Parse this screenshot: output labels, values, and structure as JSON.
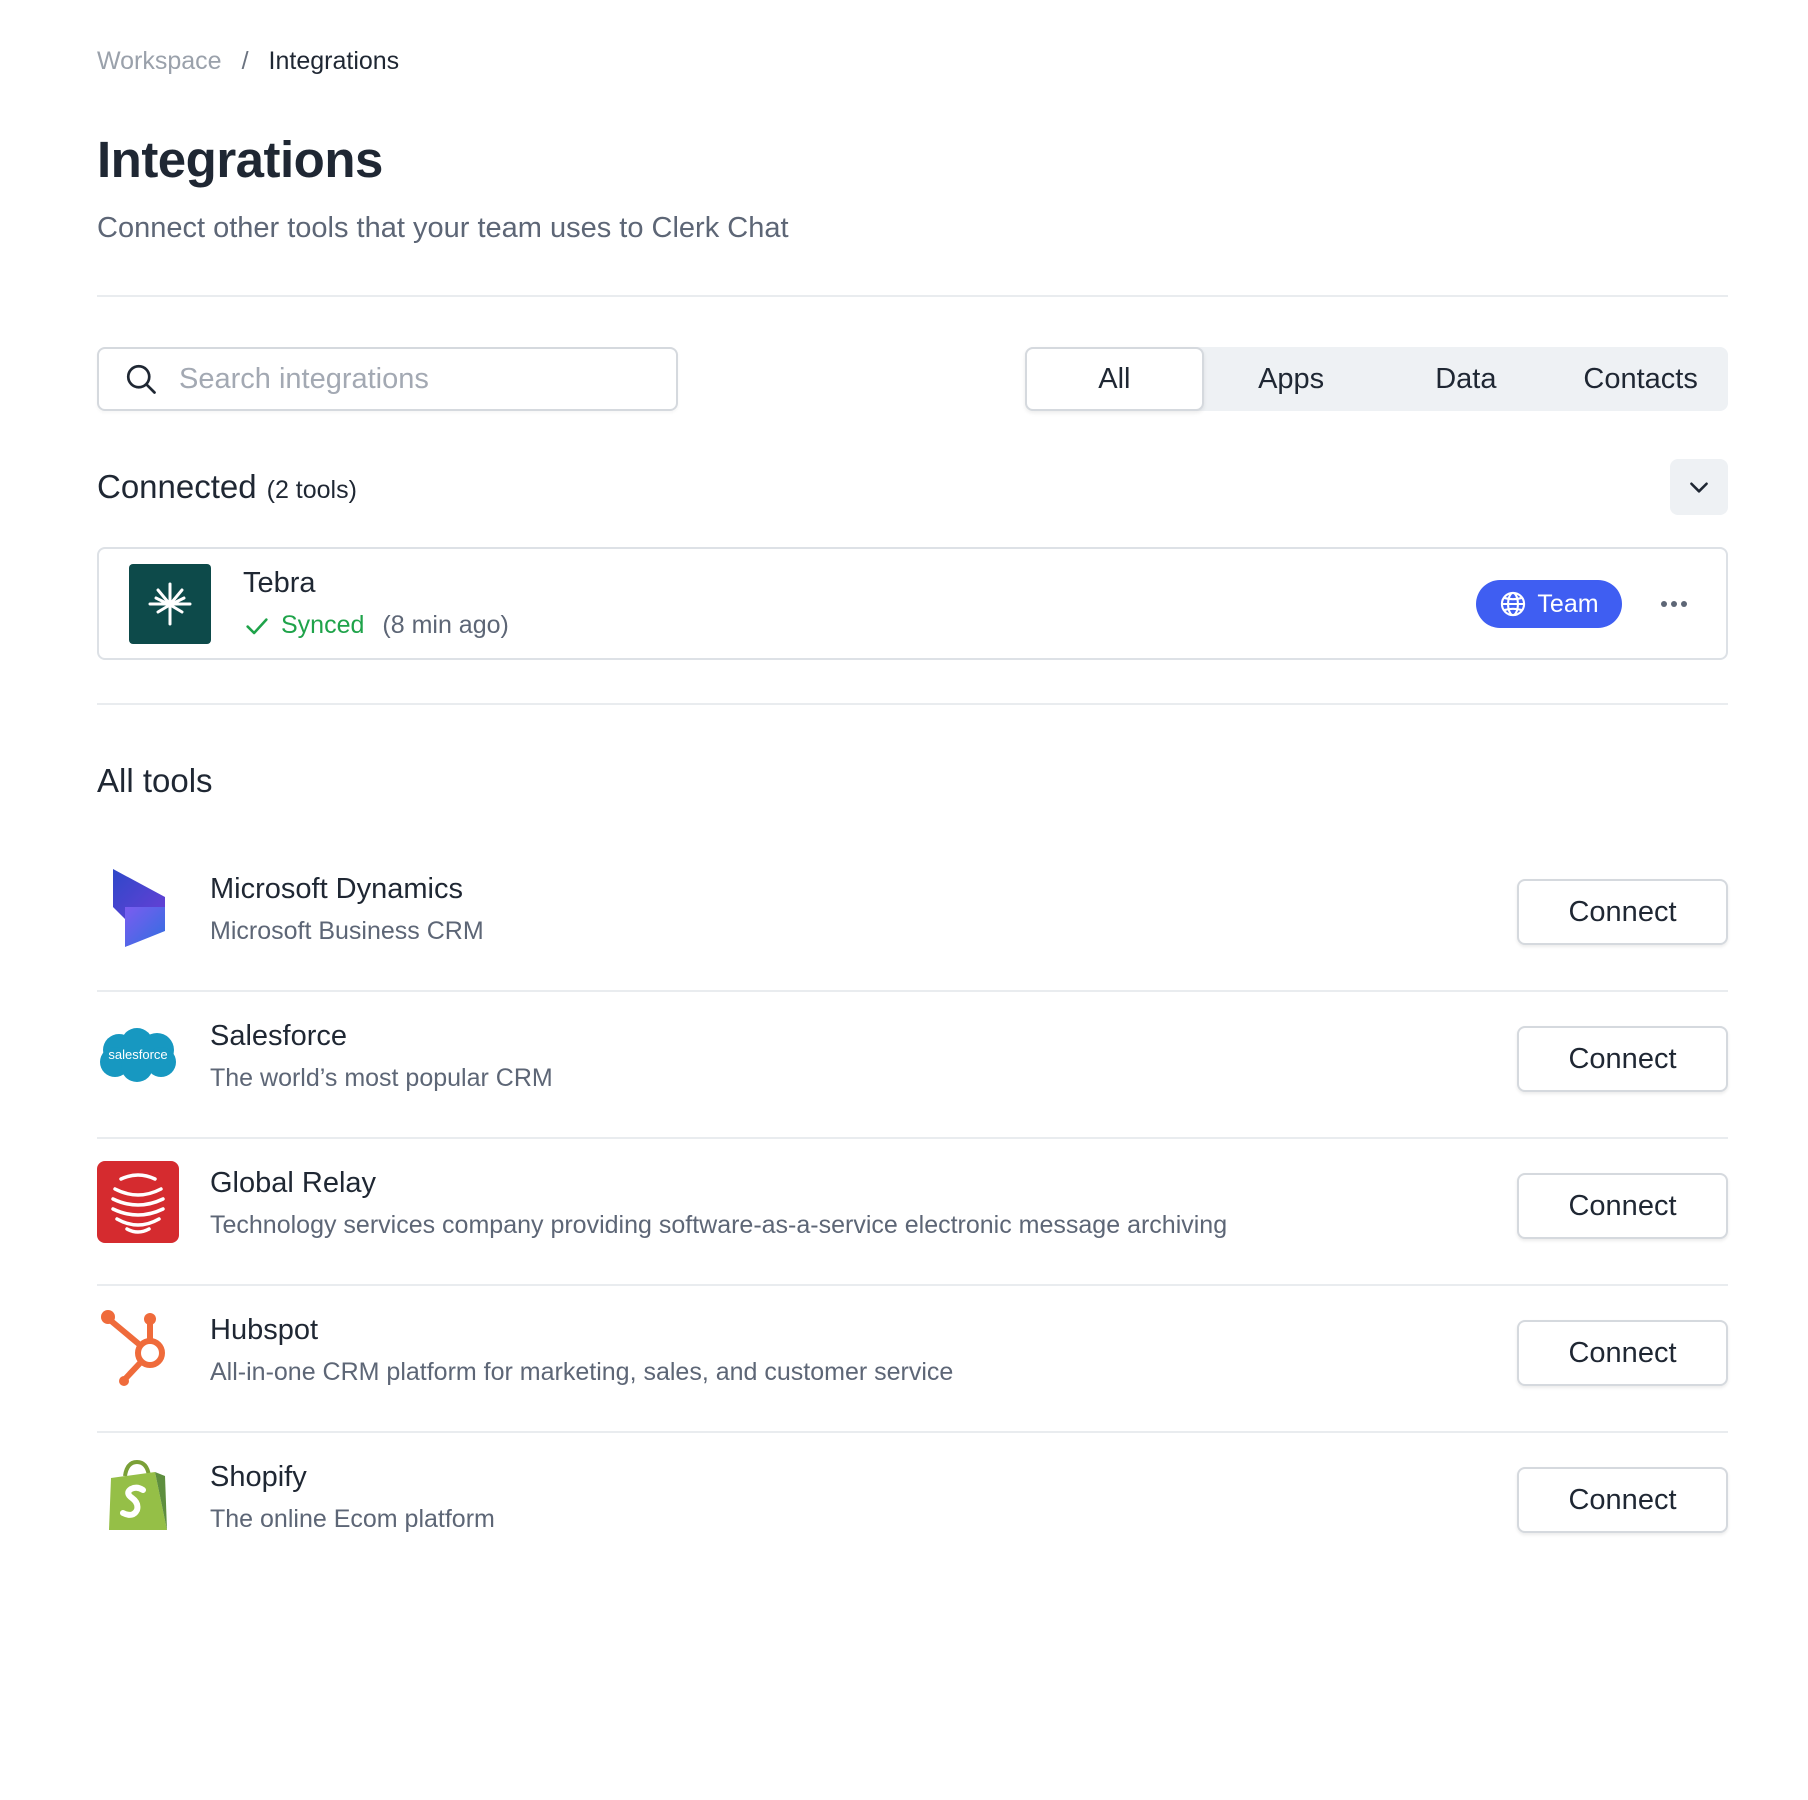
{
  "breadcrumb": {
    "parent": "Workspace",
    "separator": "/",
    "current": "Integrations"
  },
  "header": {
    "title": "Integrations",
    "subtitle": "Connect other tools that your team uses to Clerk Chat"
  },
  "search": {
    "placeholder": "Search integrations",
    "value": ""
  },
  "tabs": [
    {
      "label": "All",
      "active": true
    },
    {
      "label": "Apps",
      "active": false
    },
    {
      "label": "Data",
      "active": false
    },
    {
      "label": "Contacts",
      "active": false
    }
  ],
  "connected": {
    "title": "Connected",
    "count": "(2 tools)",
    "items": [
      {
        "name": "Tebra",
        "status": "Synced",
        "time": "(8 min ago)",
        "badge": "Team"
      }
    ]
  },
  "all_tools": {
    "title": "All tools",
    "items": [
      {
        "name": "Microsoft Dynamics",
        "description": "Microsoft Business CRM",
        "action": "Connect",
        "icon": "microsoft-dynamics-logo"
      },
      {
        "name": "Salesforce",
        "description": "The world’s most popular CRM",
        "action": "Connect",
        "icon": "salesforce-logo",
        "logo_text": "salesforce"
      },
      {
        "name": "Global Relay",
        "description": "Technology services company providing software-as-a-service electronic message archiving",
        "action": "Connect",
        "icon": "global-relay-logo"
      },
      {
        "name": "Hubspot",
        "description": "All-in-one CRM platform for marketing, sales, and customer service",
        "action": "Connect",
        "icon": "hubspot-logo"
      },
      {
        "name": "Shopify",
        "description": "The online Ecom platform",
        "action": "Connect",
        "icon": "shopify-logo"
      }
    ]
  },
  "colors": {
    "accent": "#3f5ef2",
    "success": "#1fa34a",
    "tebra": "#0d4a4a",
    "salesforce": "#1798c1",
    "global_relay": "#d52b2f",
    "hubspot": "#ef6b3b",
    "shopify": "#95bf47"
  }
}
